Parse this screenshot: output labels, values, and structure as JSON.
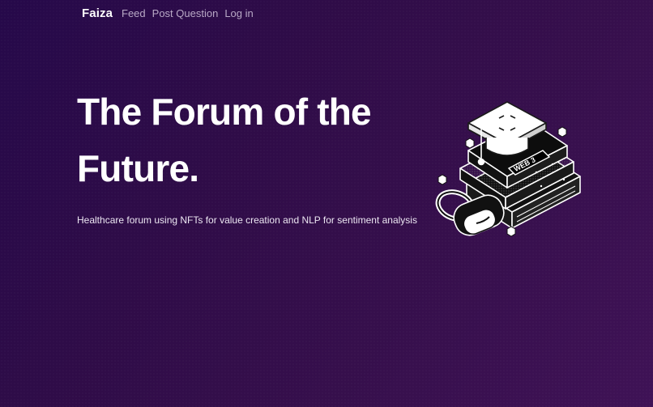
{
  "nav": {
    "brand": "Faiza",
    "links": [
      "Feed",
      "Post Question",
      "Log in"
    ]
  },
  "hero": {
    "title": "The Forum of the Future.",
    "subtitle": "Healthcare forum using NFTs for value creation and NLP for sentiment analysis"
  },
  "illustration": {
    "book_label": "WEB 3",
    "icons": [
      "graduation-cap-icon",
      "books-stack-icon",
      "vr-headset-icon",
      "cube-icon"
    ]
  },
  "colors": {
    "background_start": "#26094a",
    "background_end": "#3f1256",
    "nav_link": "#b9a9c6",
    "text": "#ffffff"
  }
}
